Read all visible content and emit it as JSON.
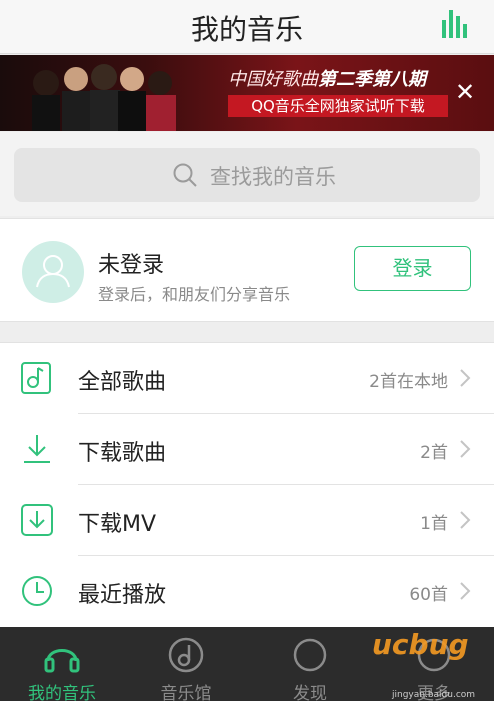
{
  "header": {
    "title": "我的音乐",
    "bars_icon": "equalizer-icon",
    "accent": "#31c27c"
  },
  "banner": {
    "line1_normal": "中国好歌曲",
    "line1_bold": "第二季第八期",
    "line2": "QQ音乐全网独家试听下载",
    "close_icon": "✕"
  },
  "search": {
    "placeholder": "查找我的音乐",
    "icon": "search-icon"
  },
  "profile": {
    "name": "未登录",
    "subtitle": "登录后，和朋友们分享音乐",
    "login_label": "登录"
  },
  "list": {
    "items": [
      {
        "label": "全部歌曲",
        "count": "2首在本地",
        "icon": "music-note-icon"
      },
      {
        "label": "下载歌曲",
        "count": "2首",
        "icon": "download-icon"
      },
      {
        "label": "下载MV",
        "count": "1首",
        "icon": "download-mv-icon"
      },
      {
        "label": "最近播放",
        "count": "60首",
        "icon": "clock-icon"
      }
    ]
  },
  "tabs": [
    {
      "label": "我的音乐",
      "icon": "headphones-icon",
      "active": true
    },
    {
      "label": "音乐馆",
      "icon": "music-hall-icon",
      "active": false
    },
    {
      "label": "发现",
      "icon": "discover-icon",
      "active": false
    },
    {
      "label": "更多",
      "icon": "more-icon",
      "active": false
    }
  ],
  "watermark": {
    "text": "ucbug",
    "sub": "jingyan.baidu.com"
  }
}
